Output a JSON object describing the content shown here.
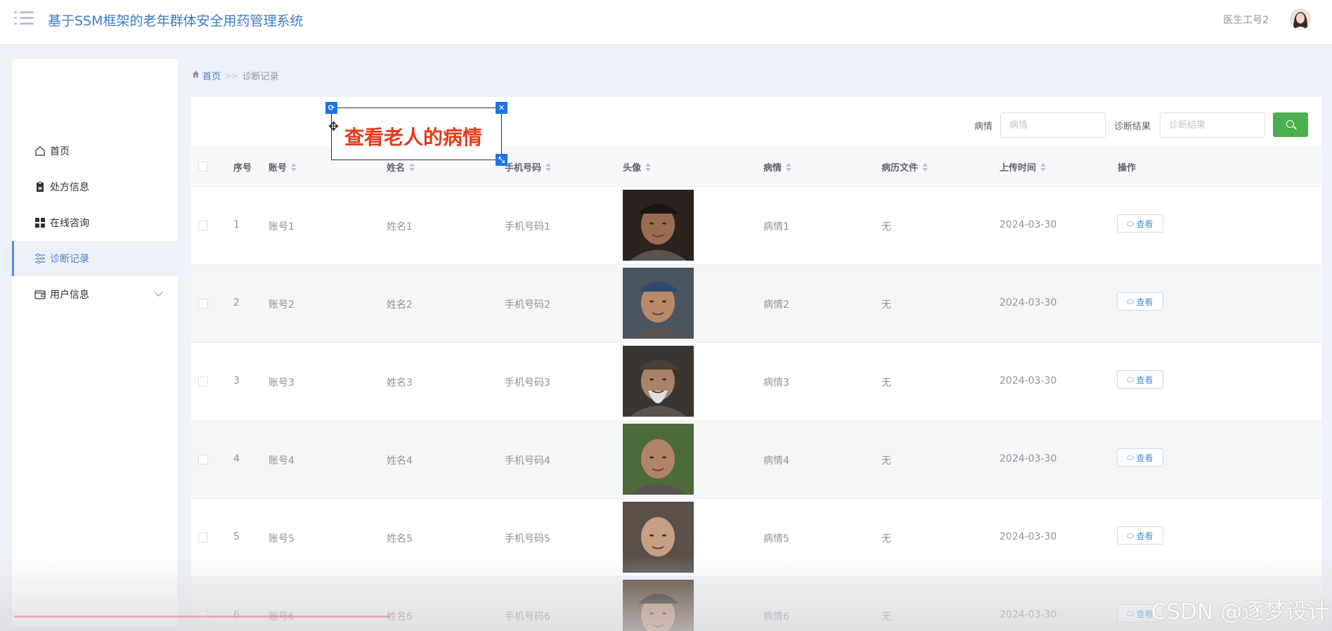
{
  "header": {
    "title": "基于SSM框架的老年群体安全用药管理系统",
    "user_name": "医生工号2"
  },
  "sidebar": {
    "items": [
      {
        "label": "首页",
        "icon": "home-icon"
      },
      {
        "label": "处方信息",
        "icon": "clipboard-icon"
      },
      {
        "label": "在线咨询",
        "icon": "grid-icon"
      },
      {
        "label": "诊断记录",
        "icon": "sliders-icon",
        "active": true
      },
      {
        "label": "用户信息",
        "icon": "wallet-icon",
        "expandable": true
      }
    ]
  },
  "breadcrumb": {
    "home": "首页",
    "separator": ">>",
    "current": "诊断记录"
  },
  "search": {
    "condition_label": "病情",
    "condition_placeholder": "病情",
    "result_label": "诊断结果",
    "result_placeholder": "诊断结果",
    "button_icon": "search-icon",
    "button_color": "#4caf50"
  },
  "table": {
    "columns": [
      "序号",
      "账号",
      "姓名",
      "手机号码",
      "头像",
      "病情",
      "病历文件",
      "上传时间",
      "操作"
    ],
    "action_label": "查看",
    "rows": [
      {
        "index": "1",
        "account": "账号1",
        "name": "姓名1",
        "phone": "手机号码1",
        "condition": "病情1",
        "file": "无",
        "time": "2024-03-30"
      },
      {
        "index": "2",
        "account": "账号2",
        "name": "姓名2",
        "phone": "手机号码2",
        "condition": "病情2",
        "file": "无",
        "time": "2024-03-30"
      },
      {
        "index": "3",
        "account": "账号3",
        "name": "姓名3",
        "phone": "手机号码3",
        "condition": "病情3",
        "file": "无",
        "time": "2024-03-30"
      },
      {
        "index": "4",
        "account": "账号4",
        "name": "姓名4",
        "phone": "手机号码4",
        "condition": "病情4",
        "file": "无",
        "time": "2024-03-30"
      },
      {
        "index": "5",
        "account": "账号5",
        "name": "姓名5",
        "phone": "手机号码5",
        "condition": "病情5",
        "file": "无",
        "time": "2024-03-30"
      },
      {
        "index": "6",
        "account": "账号6",
        "name": "姓名6",
        "phone": "手机号码6",
        "condition": "病情6",
        "file": "无",
        "time": "2024-03-30"
      }
    ]
  },
  "annotation": {
    "text": "查看老人的病情"
  },
  "watermark": "CSDN @逐梦设计",
  "colors": {
    "accent": "#4a90d9",
    "annotation_text": "#e23b1a",
    "handle": "#1e73e8"
  }
}
